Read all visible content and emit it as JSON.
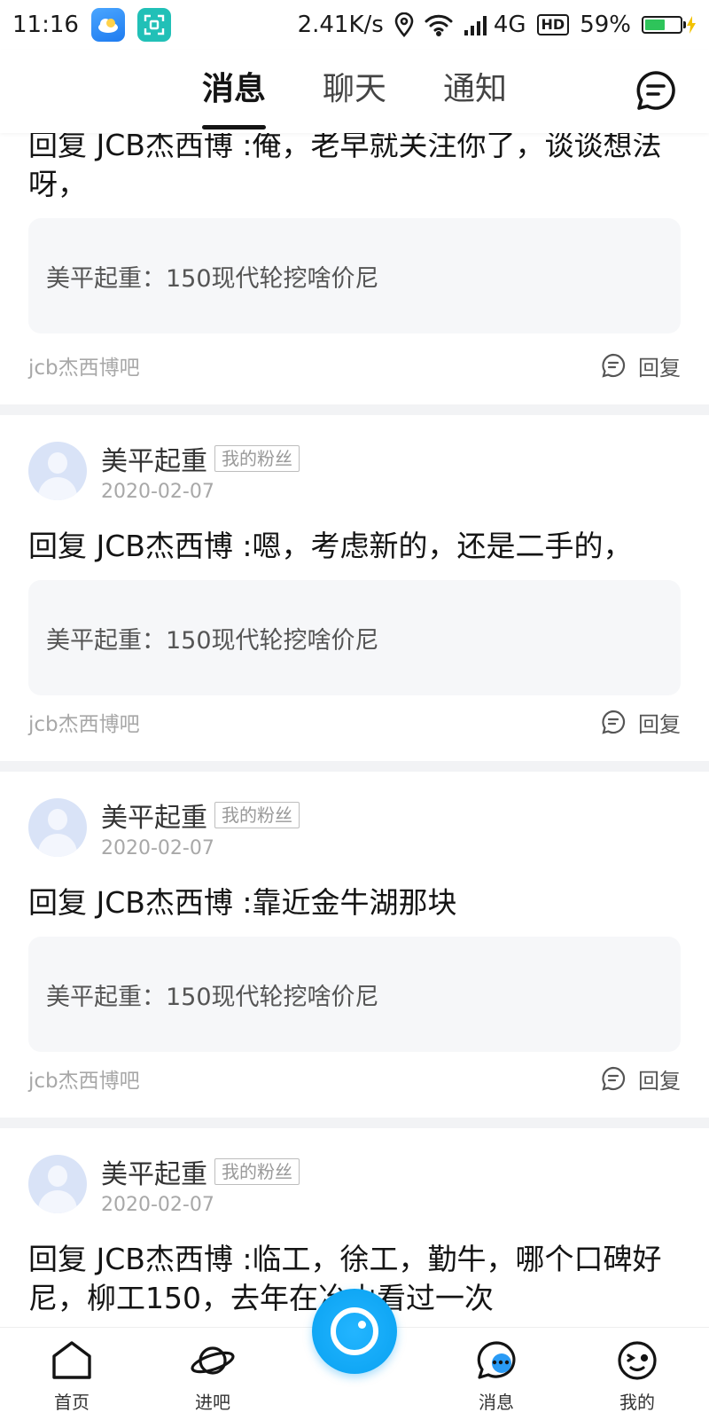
{
  "status_bar": {
    "time": "11:16",
    "network_speed": "2.41K/s",
    "network_type": "4G",
    "hd_label": "HD",
    "battery": "59%",
    "battery_level": 0.59
  },
  "header": {
    "tabs": [
      {
        "label": "消息",
        "active": true
      },
      {
        "label": "聊天",
        "active": false
      },
      {
        "label": "通知",
        "active": false
      }
    ]
  },
  "feed": {
    "first": {
      "reply_text": "回复 JCB杰西博 :俺，老早就关注你了，谈谈想法呀，",
      "quote": "美平起重：150现代轮挖啥价尼",
      "forum": "jcb杰西博吧",
      "reply_label": "回复"
    },
    "items": [
      {
        "username": "美平起重",
        "badge": "我的粉丝",
        "date": "2020-02-07",
        "reply_text": "回复 JCB杰西博 :嗯，考虑新的，还是二手的，",
        "quote": "美平起重：150现代轮挖啥价尼",
        "forum": "jcb杰西博吧",
        "reply_label": "回复"
      },
      {
        "username": "美平起重",
        "badge": "我的粉丝",
        "date": "2020-02-07",
        "reply_text": "回复 JCB杰西博 :靠近金牛湖那块",
        "quote": "美平起重：150现代轮挖啥价尼",
        "forum": "jcb杰西博吧",
        "reply_label": "回复"
      },
      {
        "username": "美平起重",
        "badge": "我的粉丝",
        "date": "2020-02-07",
        "reply_text": "回复 JCB杰西博 :临工，徐工，勤牛，哪个口碑好尼，柳工150，去年在冶山看过一次"
      }
    ]
  },
  "bottom_nav": {
    "items": [
      {
        "label": "首页",
        "icon": "home-icon"
      },
      {
        "label": "进吧",
        "icon": "planet-icon"
      },
      {
        "label": "消息",
        "icon": "message-icon"
      },
      {
        "label": "我的",
        "icon": "profile-face-icon"
      }
    ]
  }
}
